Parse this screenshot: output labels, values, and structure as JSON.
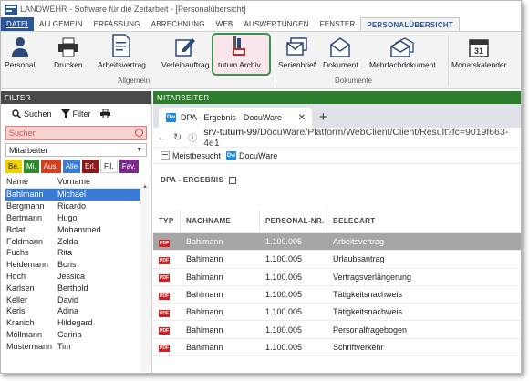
{
  "window": {
    "title": "LANDWEHR - Software für die Zeitarbeit - [Personalübersicht]"
  },
  "menu": {
    "items": [
      "DATEI",
      "ALLGEMEIN",
      "ERFASSUNG",
      "ABRECHNUNG",
      "WEB",
      "AUSWERTUNGEN",
      "FENSTER",
      "PERSONALÜBERSICHT"
    ]
  },
  "ribbon": {
    "personal": "Personal",
    "drucken": "Drucken",
    "arbeitsvertrag": "Arbeitsvertrag",
    "verleihauftrag": "Verleihauftrag",
    "tutum_archiv": "tutum Archiv",
    "serienbrief": "Serienbrief",
    "dokument": "Dokument",
    "mehrfachdokument": "Mehrfachdokument",
    "monatskalender": "Monatskalender",
    "calendar_day": "31",
    "group_allgemein": "Allgemein",
    "group_dokumente": "Dokumente"
  },
  "filter": {
    "header": "FILTER",
    "suchen": "Suchen",
    "filter": "Filter",
    "search_placeholder": "Suchen",
    "select_value": "Mitarbeiter",
    "chips": [
      {
        "label": "Be.",
        "color": "#f0d000",
        "text": "#222"
      },
      {
        "label": "Mi.",
        "color": "#2e8b2e",
        "text": "#fff"
      },
      {
        "label": "Aus.",
        "color": "#d04020",
        "text": "#fff"
      },
      {
        "label": "Alle",
        "color": "#3a7bd5",
        "text": "#fff"
      },
      {
        "label": "Erl.",
        "color": "#8b1a1a",
        "text": "#fff"
      },
      {
        "label": "Fil.",
        "color": "#ffffff",
        "text": "#222"
      },
      {
        "label": "Fav.",
        "color": "#7a2a8a",
        "text": "#fff"
      }
    ],
    "col_name": "Name",
    "col_vorname": "Vorname",
    "rows": [
      {
        "name": "Bahlmann",
        "vorname": "Michael"
      },
      {
        "name": "Bergmann",
        "vorname": "Ricardo"
      },
      {
        "name": "Bertmann",
        "vorname": "Hugo"
      },
      {
        "name": "Bolat",
        "vorname": "Mohammed"
      },
      {
        "name": "Feldmann",
        "vorname": "Zelda"
      },
      {
        "name": "Fuchs",
        "vorname": "Rita"
      },
      {
        "name": "Heidemann",
        "vorname": "Boris"
      },
      {
        "name": "Hoch",
        "vorname": "Jessica"
      },
      {
        "name": "Karlsen",
        "vorname": "Berthold"
      },
      {
        "name": "Keller",
        "vorname": "David"
      },
      {
        "name": "Kerls",
        "vorname": "Adina"
      },
      {
        "name": "Kranich",
        "vorname": "Hildegard"
      },
      {
        "name": "Möllmann",
        "vorname": "Carina"
      },
      {
        "name": "Mustermann",
        "vorname": "Tim"
      }
    ]
  },
  "main": {
    "header": "MITARBEITER",
    "tab_title": "DPA - Ergebnis - DocuWare",
    "tab_icon": "Dw",
    "url_host": "srv-tutum-99",
    "url_path": "/DocuWare/Platform/WebClient/Client/Result?fc=9019f663-4e1",
    "bookmark1": "Meistbesucht",
    "bookmark2": "DocuWare",
    "section_title": "DPA - ERGEBNIS",
    "cols": [
      "TYP",
      "NACHNAME",
      "PERSONAL-NR.",
      "BELEGART"
    ],
    "pdf_label": "PDF",
    "rows": [
      {
        "nachname": "Bahlmann",
        "nr": "1.100.005",
        "belegart": "Arbeitsvertrag"
      },
      {
        "nachname": "Bahlmann",
        "nr": "1.100.005",
        "belegart": "Urlaubsantrag"
      },
      {
        "nachname": "Bahlmann",
        "nr": "1.100.005",
        "belegart": "Vertragsverlängerung"
      },
      {
        "nachname": "Bahlmann",
        "nr": "1.100.005",
        "belegart": "Tätigkeitsnachweis"
      },
      {
        "nachname": "Bahlmann",
        "nr": "1.100.005",
        "belegart": "Tätigkeitsnachweis"
      },
      {
        "nachname": "Bahlmann",
        "nr": "1.100.005",
        "belegart": "Personalfragebogen"
      },
      {
        "nachname": "Bahlmann",
        "nr": "1.100.005",
        "belegart": "Schriftverkehr"
      }
    ]
  }
}
